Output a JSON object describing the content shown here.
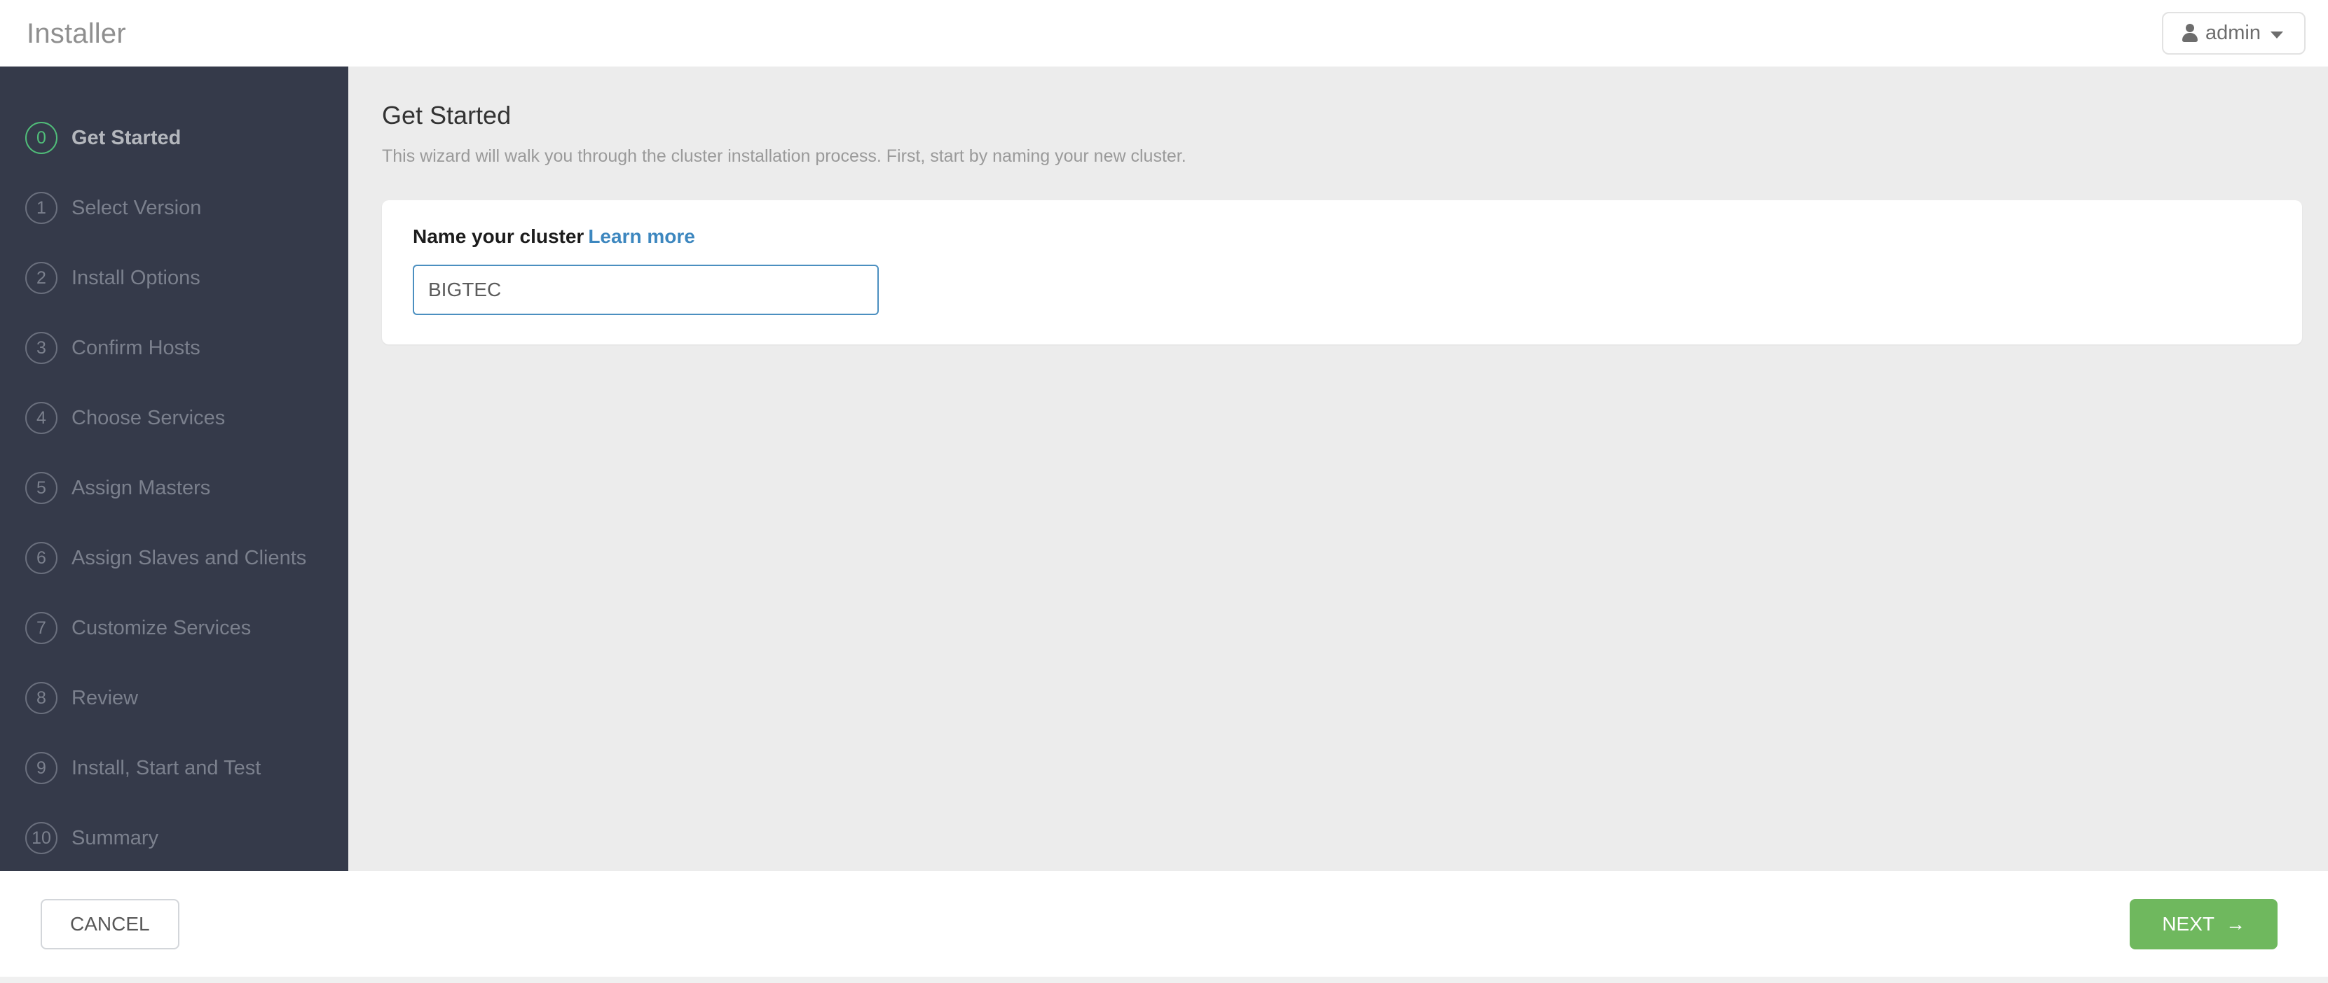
{
  "header": {
    "title": "Installer",
    "user_label": "admin",
    "user_icon": "person-icon",
    "caret_icon": "chevron-down-icon"
  },
  "sidebar": {
    "steps": [
      {
        "number": "0",
        "label": "Get Started",
        "active": true
      },
      {
        "number": "1",
        "label": "Select Version",
        "active": false
      },
      {
        "number": "2",
        "label": "Install Options",
        "active": false
      },
      {
        "number": "3",
        "label": "Confirm Hosts",
        "active": false
      },
      {
        "number": "4",
        "label": "Choose Services",
        "active": false
      },
      {
        "number": "5",
        "label": "Assign Masters",
        "active": false
      },
      {
        "number": "6",
        "label": "Assign Slaves and Clients",
        "active": false
      },
      {
        "number": "7",
        "label": "Customize Services",
        "active": false
      },
      {
        "number": "8",
        "label": "Review",
        "active": false
      },
      {
        "number": "9",
        "label": "Install, Start and Test",
        "active": false
      },
      {
        "number": "10",
        "label": "Summary",
        "active": false
      }
    ]
  },
  "main": {
    "title": "Get Started",
    "description": "This wizard will walk you through the cluster installation process. First, start by naming your new cluster.",
    "card": {
      "field_label": "Name your cluster",
      "learn_more_label": "Learn more",
      "cluster_name_value": "BIGTEC",
      "cluster_name_placeholder": ""
    }
  },
  "footer": {
    "cancel_label": "CANCEL",
    "next_label": "NEXT",
    "next_arrow": "→"
  },
  "colors": {
    "sidebar_bg": "#353a4a",
    "content_bg": "#ececec",
    "accent_green": "#50bd79",
    "next_green": "#6fb85e",
    "link_blue": "#3d87bf",
    "input_border_blue": "#4b8fc0"
  }
}
